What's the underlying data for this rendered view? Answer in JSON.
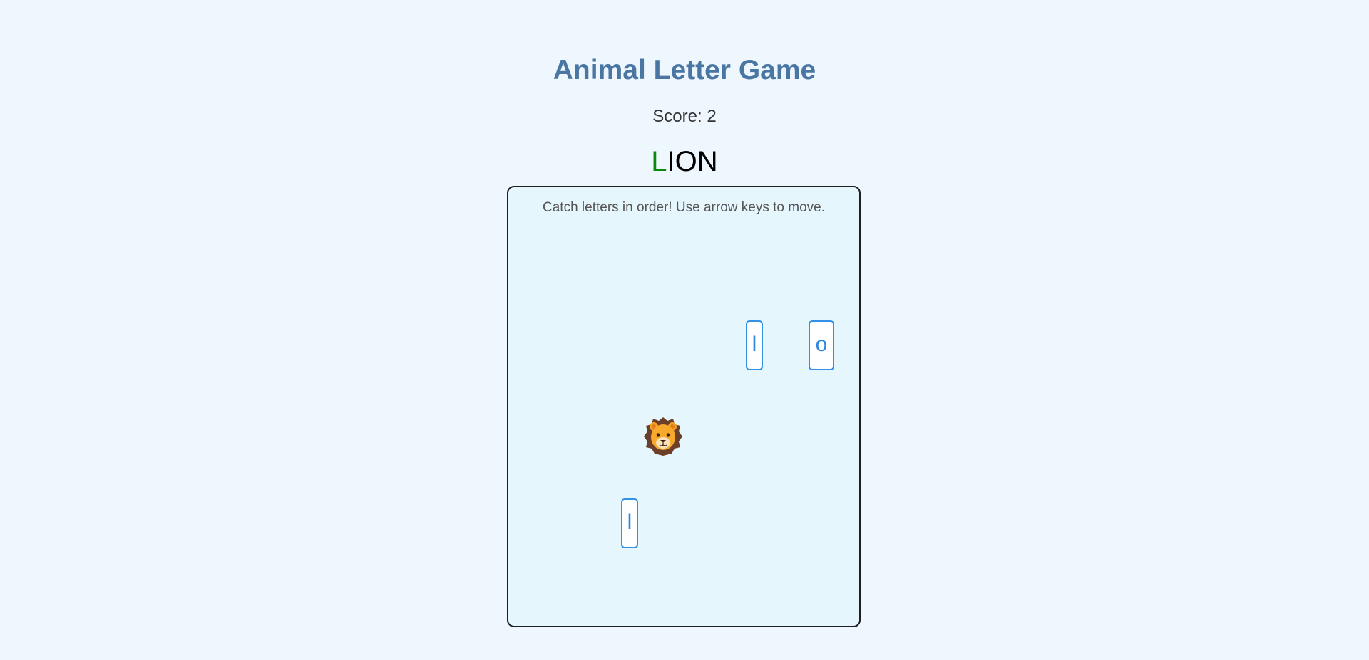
{
  "title": "Animal Letter Game",
  "score": {
    "label": "Score:",
    "value": "2"
  },
  "target_word": {
    "letters": [
      "L",
      "I",
      "O",
      "N"
    ],
    "caught_count": 1
  },
  "board": {
    "instructions": "Catch letters in order! Use arrow keys to move.",
    "player": {
      "animal": "lion",
      "icon": "lion-face-icon"
    },
    "falling_letters": [
      "l",
      "o",
      "l"
    ]
  },
  "colors": {
    "page_background": "#eff7fe",
    "title": "#4a76a3",
    "caught_letter": "#0a8a0a",
    "pending_letter": "#000000",
    "board_background": "#e5f6fd",
    "tile_border": "#3391e6",
    "tile_text": "#2f86df"
  }
}
